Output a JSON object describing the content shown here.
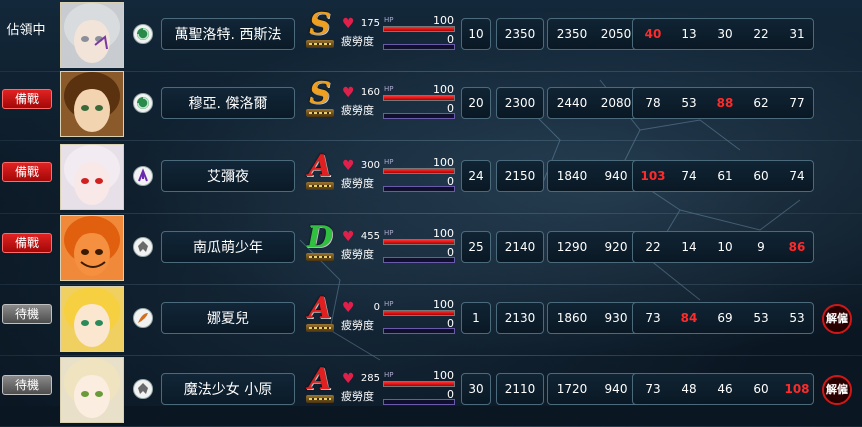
{
  "colors": {
    "highlight": "#ff2a2a",
    "rank_S": "#f0a020",
    "rank_A": "#e02020",
    "rank_D": "#30c040",
    "ready_button": "#c01010",
    "wait_button": "#6a6a6a"
  },
  "labels": {
    "hp": "HP",
    "fatigue": "疲勞度",
    "dismiss": "解僱"
  },
  "members": [
    {
      "status": "佔領中",
      "status_type": "occupy",
      "portrait": "silver-haired-man-portrait",
      "element_icon": "swirl-icon",
      "name": "萬聖洛特. 西斯法",
      "rank": "S",
      "hp": "175",
      "hp_max": "100",
      "hp_fill": 1.0,
      "fatigue": "0",
      "fatigue_fill": 0.0,
      "level": "10",
      "power": "2350",
      "val_a": "2350",
      "val_b": "2050",
      "stats": [
        "40",
        "13",
        "30",
        "22",
        "31"
      ],
      "highlight_index": 0,
      "dismissable": false
    },
    {
      "status": "備戰",
      "status_type": "ready",
      "portrait": "brown-haired-man-portrait",
      "element_icon": "swirl-icon",
      "name": "穆亞. 傑洛爾",
      "rank": "S",
      "hp": "160",
      "hp_max": "100",
      "hp_fill": 1.0,
      "fatigue": "0",
      "fatigue_fill": 0.0,
      "level": "20",
      "power": "2300",
      "val_a": "2440",
      "val_b": "2080",
      "stats": [
        "78",
        "53",
        "88",
        "62",
        "77"
      ],
      "highlight_index": 2,
      "dismissable": false
    },
    {
      "status": "備戰",
      "status_type": "ready",
      "portrait": "white-haired-girl-portrait",
      "element_icon": "claw-icon",
      "name": "艾彌夜",
      "rank": "A",
      "hp": "300",
      "hp_max": "100",
      "hp_fill": 1.0,
      "fatigue": "0",
      "fatigue_fill": 0.0,
      "level": "24",
      "power": "2150",
      "val_a": "1840",
      "val_b": "940",
      "stats": [
        "103",
        "74",
        "61",
        "60",
        "74"
      ],
      "highlight_index": 0,
      "dismissable": false
    },
    {
      "status": "備戰",
      "status_type": "ready",
      "portrait": "pumpkin-boy-portrait",
      "element_icon": "wing-icon",
      "name": "南瓜萌少年",
      "rank": "D",
      "hp": "455",
      "hp_max": "100",
      "hp_fill": 1.0,
      "fatigue": "0",
      "fatigue_fill": 0.0,
      "level": "25",
      "power": "2140",
      "val_a": "1290",
      "val_b": "920",
      "stats": [
        "22",
        "14",
        "10",
        "9",
        "86"
      ],
      "highlight_index": 4,
      "dismissable": false
    },
    {
      "status": "待機",
      "status_type": "wait",
      "portrait": "blonde-girl-portrait",
      "element_icon": "feather-icon",
      "name": "娜夏兒",
      "rank": "A",
      "hp": "0",
      "hp_max": "100",
      "hp_fill": 1.0,
      "fatigue": "0",
      "fatigue_fill": 0.0,
      "level": "1",
      "power": "2130",
      "val_a": "1860",
      "val_b": "930",
      "stats": [
        "73",
        "84",
        "69",
        "53",
        "53"
      ],
      "highlight_index": 1,
      "dismissable": true
    },
    {
      "status": "待機",
      "status_type": "wait",
      "portrait": "magical-girl-portrait",
      "element_icon": "wing-icon",
      "name": "魔法少女 小原",
      "rank": "A",
      "hp": "285",
      "hp_max": "100",
      "hp_fill": 1.0,
      "fatigue": "0",
      "fatigue_fill": 0.0,
      "level": "30",
      "power": "2110",
      "val_a": "1720",
      "val_b": "940",
      "stats": [
        "73",
        "48",
        "46",
        "60",
        "108"
      ],
      "highlight_index": 4,
      "dismissable": true
    }
  ]
}
